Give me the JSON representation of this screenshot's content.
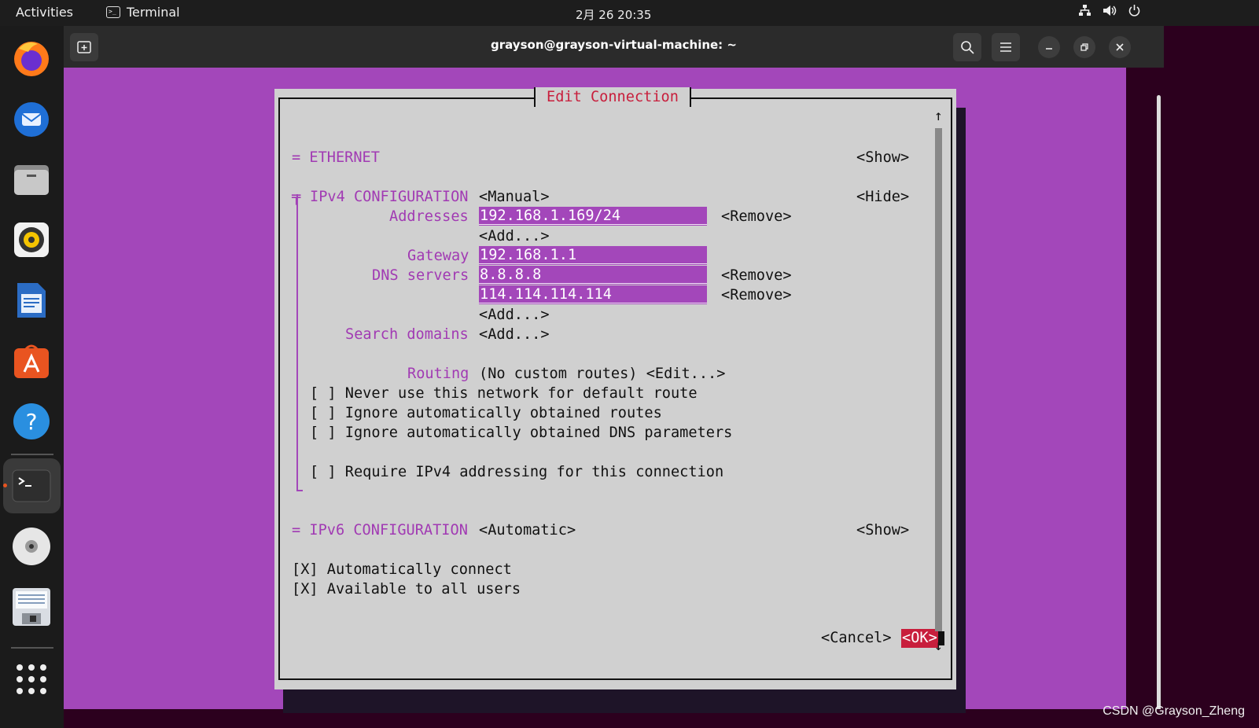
{
  "topbar": {
    "activities": "Activities",
    "app_name": "Terminal",
    "clock": "2月 26  20:35",
    "tray_icons": [
      "network-icon",
      "volume-icon",
      "power-icon"
    ]
  },
  "dock": {
    "apps": [
      "firefox",
      "thunderbird",
      "files",
      "rhythmbox",
      "libreoffice-writer",
      "app-center",
      "help",
      "terminal",
      "disc",
      "floppy"
    ],
    "active_app": "terminal",
    "accent_color": "#e95420"
  },
  "window": {
    "title": "grayson@grayson-virtual-machine: ~"
  },
  "dialog": {
    "title": "Edit Connection",
    "ethernet": {
      "label": "= ETHERNET",
      "toggle": "<Show>"
    },
    "ipv4": {
      "label": "IPv4 CONFIGURATION",
      "marker": "╤",
      "mode": "<Manual>",
      "toggle": "<Hide>",
      "addresses_label": "Addresses",
      "addresses": [
        "192.168.1.169/24"
      ],
      "remove": "<Remove>",
      "add": "<Add...>",
      "gateway_label": "Gateway",
      "gateway": "192.168.1.1",
      "dns_label": "DNS servers",
      "dns": [
        "8.8.8.8",
        "114.114.114.114"
      ],
      "search_label": "Search domains",
      "routing_label": "Routing",
      "routing_value": "(No custom routes) <Edit...>",
      "checkboxes": [
        "[ ] Never use this network for default route",
        "[ ] Ignore automatically obtained routes",
        "[ ] Ignore automatically obtained DNS parameters",
        "[ ] Require IPv4 addressing for this connection"
      ]
    },
    "ipv6": {
      "label": "= IPv6 CONFIGURATION",
      "mode": "<Automatic>",
      "toggle": "<Show>"
    },
    "options": [
      "[X] Automatically connect",
      "[X] Available to all users"
    ],
    "cancel": "<Cancel>",
    "ok": "<OK>",
    "scroll_up": "↑",
    "scroll_down": "↓"
  },
  "colors": {
    "terminal_bg": "#a347ba",
    "dialog_bg": "#d0d0d0",
    "title_red": "#c81e3c",
    "label_magenta": "#a13ab3"
  },
  "watermark": "CSDN @Grayson_Zheng"
}
